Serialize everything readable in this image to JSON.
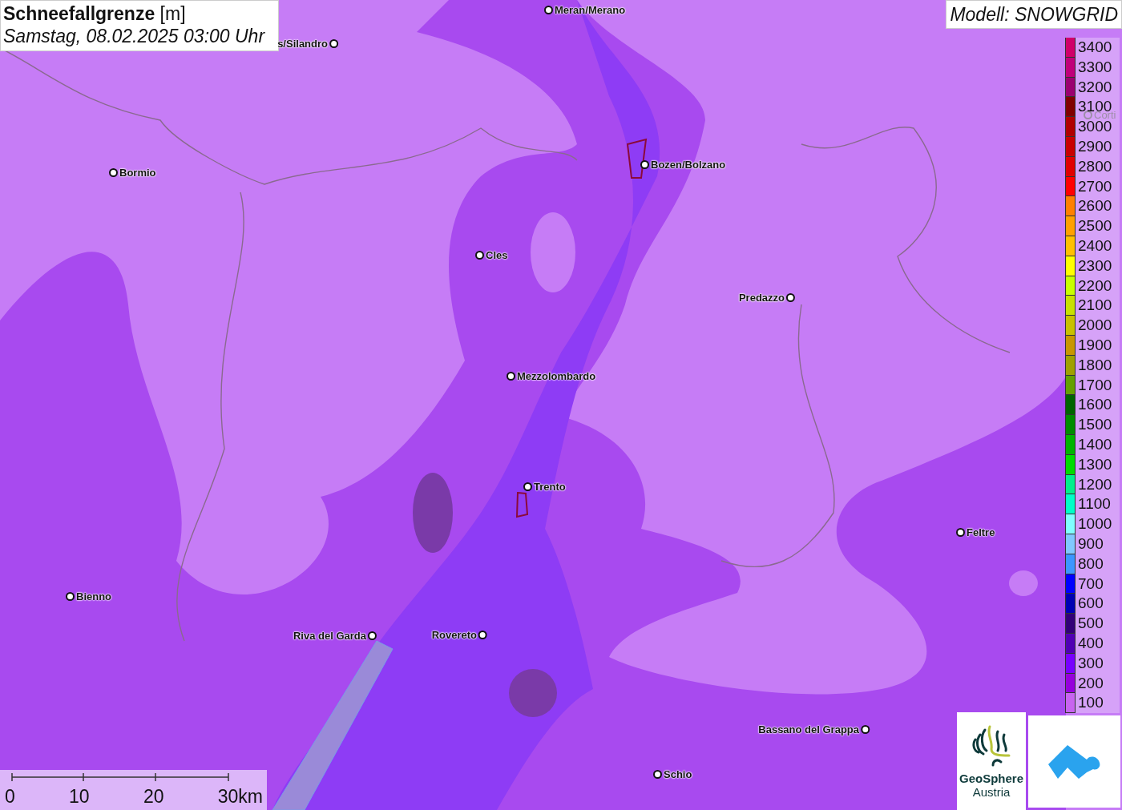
{
  "header": {
    "title": "**Schneefallgrenze** [m]",
    "subtitle": "Samstag, 08.02.2025 03:00 Uhr"
  },
  "model_label": "Modell: SNOWGRID",
  "places": [
    {
      "name": "Meran/Merano"
    },
    {
      "name": "s/Silandro"
    },
    {
      "name": "Bormio"
    },
    {
      "name": "Bozen/Bolzano"
    },
    {
      "name": "Cles"
    },
    {
      "name": "Predazzo"
    },
    {
      "name": "Mezzolombardo"
    },
    {
      "name": "Trento"
    },
    {
      "name": "Feltre"
    },
    {
      "name": "Bienno"
    },
    {
      "name": "Riva del Garda"
    },
    {
      "name": "Rovereto"
    },
    {
      "name": "Bassano del Grappa"
    },
    {
      "name": "Schio"
    },
    {
      "name": "Corti"
    }
  ],
  "legend": [
    {
      "label": "3400",
      "color": "#d0006a"
    },
    {
      "label": "3300",
      "color": "#c0007a"
    },
    {
      "label": "3200",
      "color": "#9b0070"
    },
    {
      "label": "3100",
      "color": "#800000"
    },
    {
      "label": "3000",
      "color": "#b00000"
    },
    {
      "label": "2900",
      "color": "#c80000"
    },
    {
      "label": "2800",
      "color": "#e00000"
    },
    {
      "label": "2700",
      "color": "#ff0000"
    },
    {
      "label": "2600",
      "color": "#ff8000"
    },
    {
      "label": "2500",
      "color": "#ffa000"
    },
    {
      "label": "2400",
      "color": "#ffc000"
    },
    {
      "label": "2300",
      "color": "#ffff00"
    },
    {
      "label": "2200",
      "color": "#c8ff00"
    },
    {
      "label": "2100",
      "color": "#c8e000"
    },
    {
      "label": "2000",
      "color": "#c8c000"
    },
    {
      "label": "1900",
      "color": "#c89600"
    },
    {
      "label": "1800",
      "color": "#a0a000"
    },
    {
      "label": "1700",
      "color": "#64a000"
    },
    {
      "label": "1600",
      "color": "#006400"
    },
    {
      "label": "1500",
      "color": "#008c00"
    },
    {
      "label": "1400",
      "color": "#00b400"
    },
    {
      "label": "1300",
      "color": "#00dc00"
    },
    {
      "label": "1200",
      "color": "#00f08c"
    },
    {
      "label": "1100",
      "color": "#00ffc8"
    },
    {
      "label": "1000",
      "color": "#80ffff"
    },
    {
      "label": "900",
      "color": "#80c8ff"
    },
    {
      "label": "800",
      "color": "#3c96ff"
    },
    {
      "label": "700",
      "color": "#0000ff"
    },
    {
      "label": "600",
      "color": "#0000b4"
    },
    {
      "label": "500",
      "color": "#320078"
    },
    {
      "label": "400",
      "color": "#5000b4"
    },
    {
      "label": "300",
      "color": "#7800ff"
    },
    {
      "label": "200",
      "color": "#9600dc"
    },
    {
      "label": "100",
      "color": "#c864f0"
    }
  ],
  "scale": [
    "0",
    "10",
    "20",
    "30km"
  ],
  "logo": {
    "name": "GeoSphere",
    "sub": "Austria"
  }
}
